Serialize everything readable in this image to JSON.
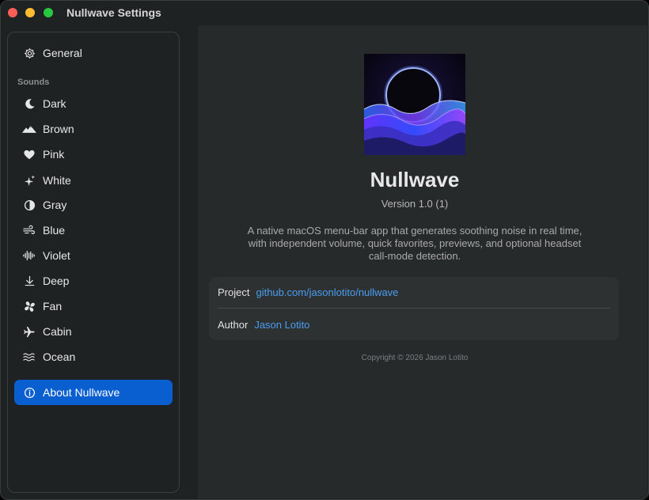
{
  "window": {
    "title": "Nullwave Settings"
  },
  "sidebar": {
    "general": {
      "label": "General",
      "icon": "gear-icon"
    },
    "section_label": "Sounds",
    "sounds": [
      {
        "label": "Dark",
        "icon": "moon-icon"
      },
      {
        "label": "Brown",
        "icon": "mountains-icon"
      },
      {
        "label": "Pink",
        "icon": "heart-icon"
      },
      {
        "label": "White",
        "icon": "sparkles-icon"
      },
      {
        "label": "Gray",
        "icon": "half-circle-icon"
      },
      {
        "label": "Blue",
        "icon": "wind-icon"
      },
      {
        "label": "Violet",
        "icon": "waveform-icon"
      },
      {
        "label": "Deep",
        "icon": "arrow-down-to-line-icon"
      },
      {
        "label": "Fan",
        "icon": "fan-icon"
      },
      {
        "label": "Cabin",
        "icon": "airplane-icon"
      },
      {
        "label": "Ocean",
        "icon": "water-waves-icon"
      }
    ],
    "about": {
      "label": "About Nullwave",
      "icon": "info-circle-icon",
      "selected": true
    }
  },
  "about": {
    "app_name": "Nullwave",
    "version": "Version 1.0 (1)",
    "description_lines": [
      "A native macOS menu-bar app that generates soothing noise in real time,",
      "with independent volume, quick favorites, previews, and optional headset",
      "call-mode detection."
    ],
    "project_label": "Project",
    "project_link": "github.com/jasonlotito/nullwave",
    "author_label": "Author",
    "author_link": "Jason Lotito",
    "copyright": "Copyright © 2026 Jason Lotito"
  },
  "colors": {
    "accent": "#0a5fd0",
    "link": "#4a9df0",
    "background": "#1f2223",
    "panel": "#262a2b"
  }
}
